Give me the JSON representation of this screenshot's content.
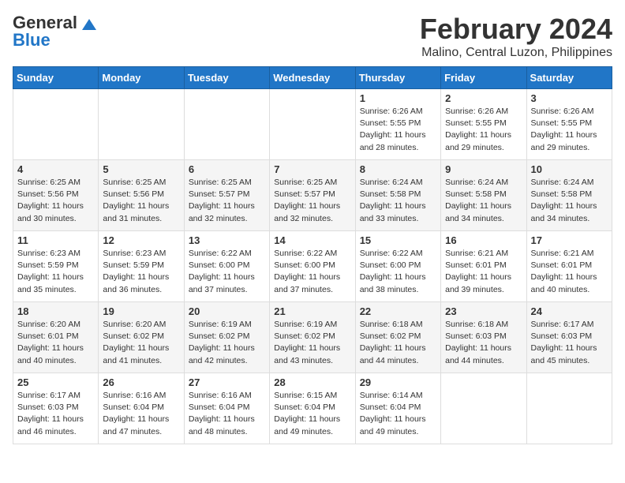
{
  "logo": {
    "line1": "General",
    "line2": "Blue"
  },
  "title": "February 2024",
  "subtitle": "Malino, Central Luzon, Philippines",
  "days_of_week": [
    "Sunday",
    "Monday",
    "Tuesday",
    "Wednesday",
    "Thursday",
    "Friday",
    "Saturday"
  ],
  "weeks": [
    [
      {
        "day": "",
        "info": ""
      },
      {
        "day": "",
        "info": ""
      },
      {
        "day": "",
        "info": ""
      },
      {
        "day": "",
        "info": ""
      },
      {
        "day": "1",
        "info": "Sunrise: 6:26 AM\nSunset: 5:55 PM\nDaylight: 11 hours\nand 28 minutes."
      },
      {
        "day": "2",
        "info": "Sunrise: 6:26 AM\nSunset: 5:55 PM\nDaylight: 11 hours\nand 29 minutes."
      },
      {
        "day": "3",
        "info": "Sunrise: 6:26 AM\nSunset: 5:55 PM\nDaylight: 11 hours\nand 29 minutes."
      }
    ],
    [
      {
        "day": "4",
        "info": "Sunrise: 6:25 AM\nSunset: 5:56 PM\nDaylight: 11 hours\nand 30 minutes."
      },
      {
        "day": "5",
        "info": "Sunrise: 6:25 AM\nSunset: 5:56 PM\nDaylight: 11 hours\nand 31 minutes."
      },
      {
        "day": "6",
        "info": "Sunrise: 6:25 AM\nSunset: 5:57 PM\nDaylight: 11 hours\nand 32 minutes."
      },
      {
        "day": "7",
        "info": "Sunrise: 6:25 AM\nSunset: 5:57 PM\nDaylight: 11 hours\nand 32 minutes."
      },
      {
        "day": "8",
        "info": "Sunrise: 6:24 AM\nSunset: 5:58 PM\nDaylight: 11 hours\nand 33 minutes."
      },
      {
        "day": "9",
        "info": "Sunrise: 6:24 AM\nSunset: 5:58 PM\nDaylight: 11 hours\nand 34 minutes."
      },
      {
        "day": "10",
        "info": "Sunrise: 6:24 AM\nSunset: 5:58 PM\nDaylight: 11 hours\nand 34 minutes."
      }
    ],
    [
      {
        "day": "11",
        "info": "Sunrise: 6:23 AM\nSunset: 5:59 PM\nDaylight: 11 hours\nand 35 minutes."
      },
      {
        "day": "12",
        "info": "Sunrise: 6:23 AM\nSunset: 5:59 PM\nDaylight: 11 hours\nand 36 minutes."
      },
      {
        "day": "13",
        "info": "Sunrise: 6:22 AM\nSunset: 6:00 PM\nDaylight: 11 hours\nand 37 minutes."
      },
      {
        "day": "14",
        "info": "Sunrise: 6:22 AM\nSunset: 6:00 PM\nDaylight: 11 hours\nand 37 minutes."
      },
      {
        "day": "15",
        "info": "Sunrise: 6:22 AM\nSunset: 6:00 PM\nDaylight: 11 hours\nand 38 minutes."
      },
      {
        "day": "16",
        "info": "Sunrise: 6:21 AM\nSunset: 6:01 PM\nDaylight: 11 hours\nand 39 minutes."
      },
      {
        "day": "17",
        "info": "Sunrise: 6:21 AM\nSunset: 6:01 PM\nDaylight: 11 hours\nand 40 minutes."
      }
    ],
    [
      {
        "day": "18",
        "info": "Sunrise: 6:20 AM\nSunset: 6:01 PM\nDaylight: 11 hours\nand 40 minutes."
      },
      {
        "day": "19",
        "info": "Sunrise: 6:20 AM\nSunset: 6:02 PM\nDaylight: 11 hours\nand 41 minutes."
      },
      {
        "day": "20",
        "info": "Sunrise: 6:19 AM\nSunset: 6:02 PM\nDaylight: 11 hours\nand 42 minutes."
      },
      {
        "day": "21",
        "info": "Sunrise: 6:19 AM\nSunset: 6:02 PM\nDaylight: 11 hours\nand 43 minutes."
      },
      {
        "day": "22",
        "info": "Sunrise: 6:18 AM\nSunset: 6:02 PM\nDaylight: 11 hours\nand 44 minutes."
      },
      {
        "day": "23",
        "info": "Sunrise: 6:18 AM\nSunset: 6:03 PM\nDaylight: 11 hours\nand 44 minutes."
      },
      {
        "day": "24",
        "info": "Sunrise: 6:17 AM\nSunset: 6:03 PM\nDaylight: 11 hours\nand 45 minutes."
      }
    ],
    [
      {
        "day": "25",
        "info": "Sunrise: 6:17 AM\nSunset: 6:03 PM\nDaylight: 11 hours\nand 46 minutes."
      },
      {
        "day": "26",
        "info": "Sunrise: 6:16 AM\nSunset: 6:04 PM\nDaylight: 11 hours\nand 47 minutes."
      },
      {
        "day": "27",
        "info": "Sunrise: 6:16 AM\nSunset: 6:04 PM\nDaylight: 11 hours\nand 48 minutes."
      },
      {
        "day": "28",
        "info": "Sunrise: 6:15 AM\nSunset: 6:04 PM\nDaylight: 11 hours\nand 49 minutes."
      },
      {
        "day": "29",
        "info": "Sunrise: 6:14 AM\nSunset: 6:04 PM\nDaylight: 11 hours\nand 49 minutes."
      },
      {
        "day": "",
        "info": ""
      },
      {
        "day": "",
        "info": ""
      }
    ]
  ]
}
